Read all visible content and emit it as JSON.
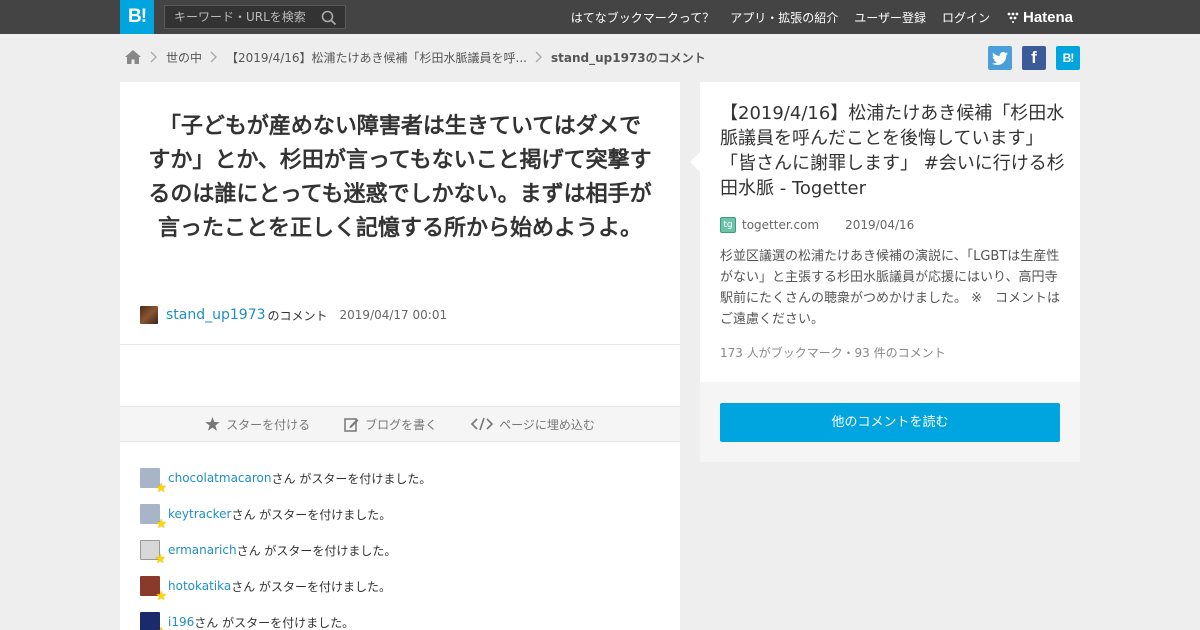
{
  "topbar": {
    "logo": "B!",
    "search_placeholder": "キーワード・URLを検索",
    "nav": [
      "はてなブックマークって？",
      "アプリ・拡張の紹介",
      "ユーザー登録",
      "ログイン"
    ],
    "brand": "Hatena"
  },
  "breadcrumb": {
    "items": [
      "世の中",
      "【2019/4/16】松浦たけあき候補「杉田水脈議員を呼..."
    ],
    "current": "stand_up1973のコメント"
  },
  "share": {
    "facebook": "f",
    "hatena": "B!"
  },
  "comment": {
    "text": "「子どもが産めない障害者は生きていてはダメですか」とか、杉田が言ってもないこと掲げて突撃するのは誰にとっても迷惑でしかない。まずは相手が言ったことを正しく記憶する所から始めようよ。",
    "user": "stand_up1973",
    "suffix": "のコメント",
    "timestamp": "2019/04/17 00:01"
  },
  "actions": {
    "star": "スターを付ける",
    "blog": "ブログを書く",
    "embed": "ページに埋め込む"
  },
  "stars": {
    "suffix": "さん がスターを付けました。",
    "users": [
      {
        "name": "chocolatmacaron",
        "avatar_color": "#a8b4c8"
      },
      {
        "name": "keytracker",
        "avatar_color": "#a8b4c8"
      },
      {
        "name": "ermanarich",
        "avatar_color": "#d8d8d8"
      },
      {
        "name": "hotokatika",
        "avatar_color": "#8a3a2a"
      },
      {
        "name": "i196",
        "avatar_color": "#1a2a6a"
      }
    ]
  },
  "entry": {
    "title": "【2019/4/16】松浦たけあき候補「杉田水脈議員を呼んだことを後悔しています」「皆さんに謝罪します」 #会いに行ける杉田水脈 - Togetter",
    "site": "togetter.com",
    "date": "2019/04/16",
    "description": "杉並区議選の松浦たけあき候補の演説に、「LGBTは生産性がない」と主張する杉田水脈議員が応援にはいり、高円寺駅前にたくさんの聴衆がつめかけました。 ※　コメントはご遠慮ください。",
    "counts": "173 人がブックマーク・93 件のコメント",
    "read_more": "他のコメントを読む"
  },
  "colors": {
    "accent": "#00a4de",
    "topbar": "#444444",
    "link": "#1e8fc4",
    "twitter": "#4a9fda",
    "facebook": "#3b5b98",
    "star": "#ffd600"
  }
}
